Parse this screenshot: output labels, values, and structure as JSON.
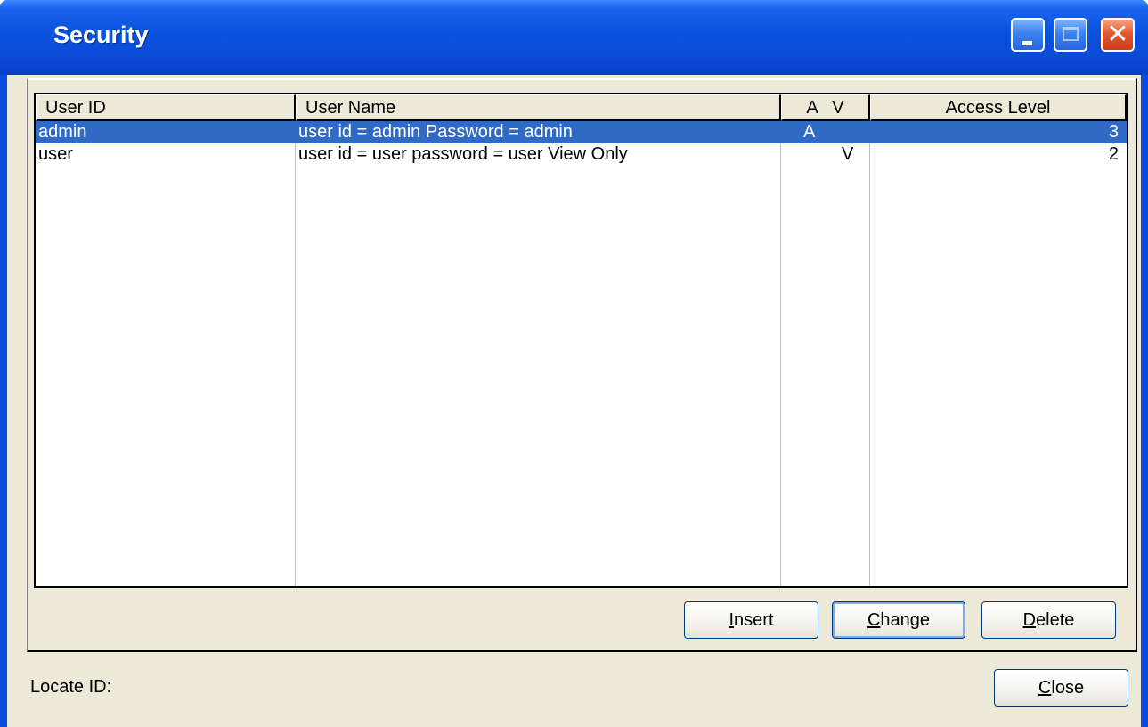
{
  "window": {
    "title": "Security",
    "controls": {
      "minimize": "minimize",
      "maximize": "maximize",
      "close": "close"
    }
  },
  "table": {
    "columns": [
      {
        "label": "User ID"
      },
      {
        "label": "User Name"
      },
      {
        "label": "A   V"
      },
      {
        "label": "Access Level"
      }
    ],
    "rows": [
      {
        "user_id": "admin",
        "user_name": "user id = admin Password = admin",
        "a": "A",
        "v": "",
        "access_level": "3",
        "selected": true
      },
      {
        "user_id": "user",
        "user_name": "user id = user password = user View Only",
        "a": "",
        "v": "V",
        "access_level": "2",
        "selected": false
      }
    ]
  },
  "buttons": {
    "insert": {
      "first": "I",
      "rest": "nsert"
    },
    "change": {
      "first": "C",
      "rest": "hange"
    },
    "delete": {
      "first": "D",
      "rest": "elete"
    },
    "close": {
      "first": "C",
      "rest": "lose"
    }
  },
  "footer": {
    "locate_label": "Locate ID:"
  }
}
